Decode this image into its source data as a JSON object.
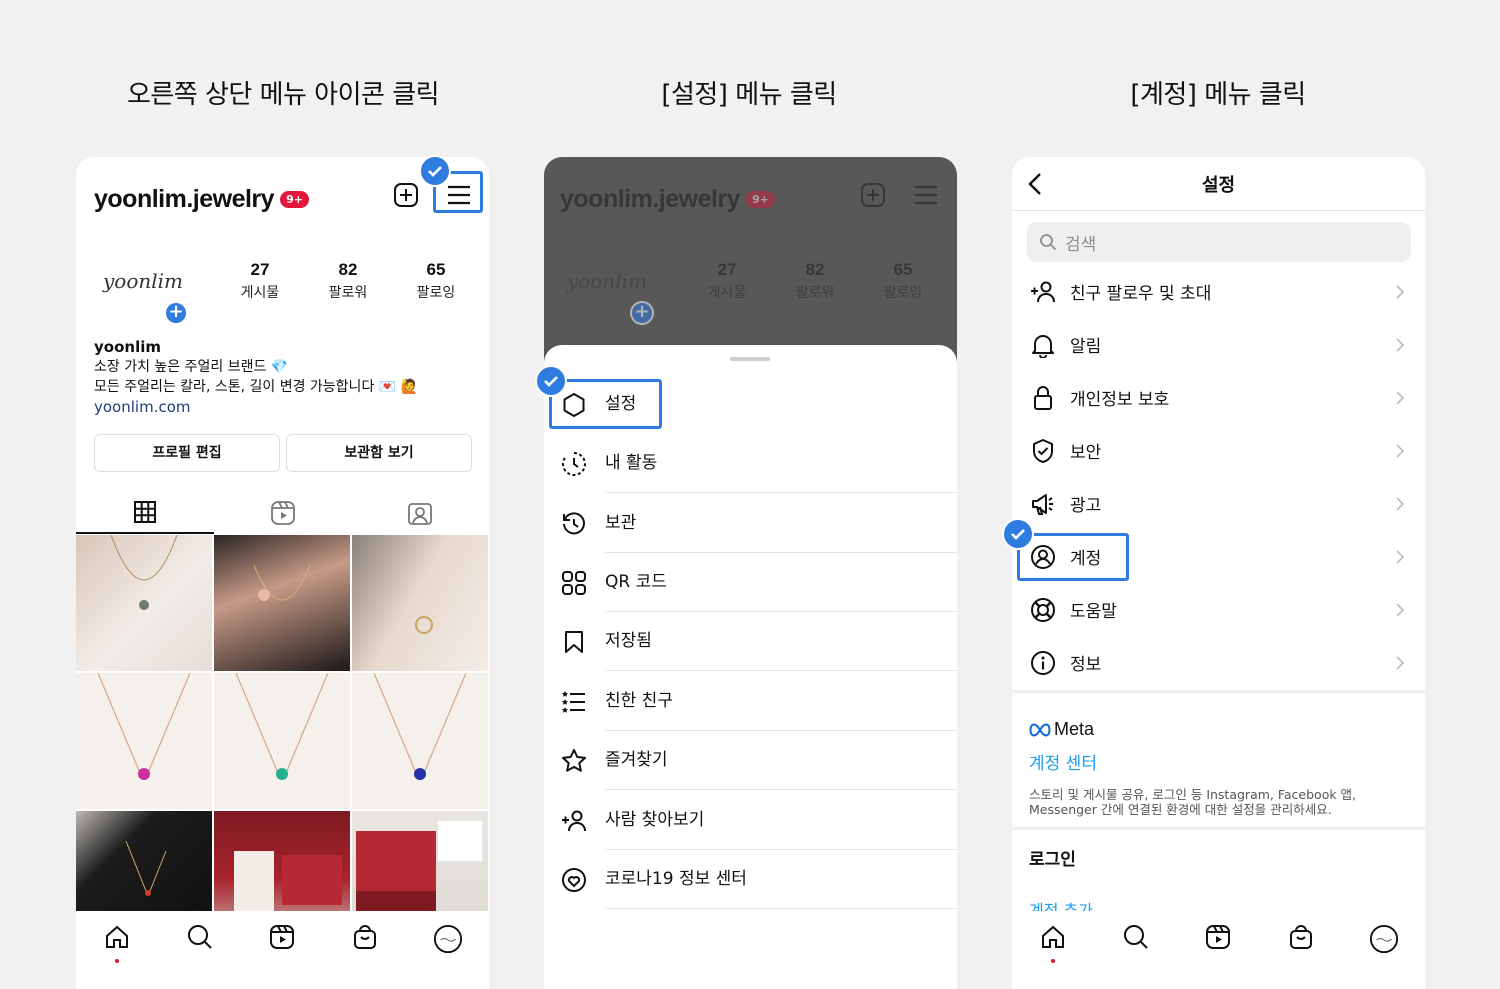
{
  "steps": [
    {
      "title": "오른쪽 상단 메뉴 아이콘 클릭"
    },
    {
      "title": "[설정] 메뉴 클릭"
    },
    {
      "title": "[계정] 메뉴 클릭"
    }
  ],
  "profile": {
    "username": "yoonlim.jewelry",
    "notification_badge": "9+",
    "logo_text": "yoonlim",
    "stats": [
      {
        "value": "27",
        "label": "게시물"
      },
      {
        "value": "82",
        "label": "팔로워"
      },
      {
        "value": "65",
        "label": "팔로잉"
      }
    ],
    "bio_name": "yoonlim",
    "bio_line1": "소장 가치 높은 주얼리 브랜드 💎",
    "bio_line2": "모든 주얼리는 칼라, 스톤, 길이 변경 가능합니다 💌 🙋",
    "bio_link": "yoonlim.com",
    "edit_button": "프로필 편집",
    "archive_button": "보관함 보기"
  },
  "menu_items": [
    {
      "label": "설정",
      "icon": "settings-icon"
    },
    {
      "label": "내 활동",
      "icon": "activity-icon"
    },
    {
      "label": "보관",
      "icon": "archive-icon"
    },
    {
      "label": "QR 코드",
      "icon": "qr-code-icon"
    },
    {
      "label": "저장됨",
      "icon": "bookmark-icon"
    },
    {
      "label": "친한 친구",
      "icon": "close-friends-icon"
    },
    {
      "label": "즐겨찾기",
      "icon": "star-icon"
    },
    {
      "label": "사람 찾아보기",
      "icon": "add-person-icon"
    },
    {
      "label": "코로나19 정보 센터",
      "icon": "covid-info-icon"
    }
  ],
  "settings": {
    "title": "설정",
    "search_placeholder": "검색",
    "items": [
      {
        "label": "친구 팔로우 및 초대",
        "icon": "add-person-icon"
      },
      {
        "label": "알림",
        "icon": "bell-icon"
      },
      {
        "label": "개인정보 보호",
        "icon": "lock-icon"
      },
      {
        "label": "보안",
        "icon": "shield-icon"
      },
      {
        "label": "광고",
        "icon": "megaphone-icon"
      },
      {
        "label": "계정",
        "icon": "account-icon"
      },
      {
        "label": "도움말",
        "icon": "lifebuoy-icon"
      },
      {
        "label": "정보",
        "icon": "info-icon"
      }
    ],
    "meta_brand": "Meta",
    "accounts_center": "계정 센터",
    "meta_description": "스토리 및 게시물 공유, 로그인 등 Instagram, Facebook 앱, Messenger 간에 연결된 환경에 대한 설정을 관리하세요.",
    "login_heading": "로그인",
    "add_account": "계정 추가"
  },
  "colors": {
    "highlight": "#2f7ce0",
    "link": "#1a9df0",
    "badge": "#e3163c"
  }
}
